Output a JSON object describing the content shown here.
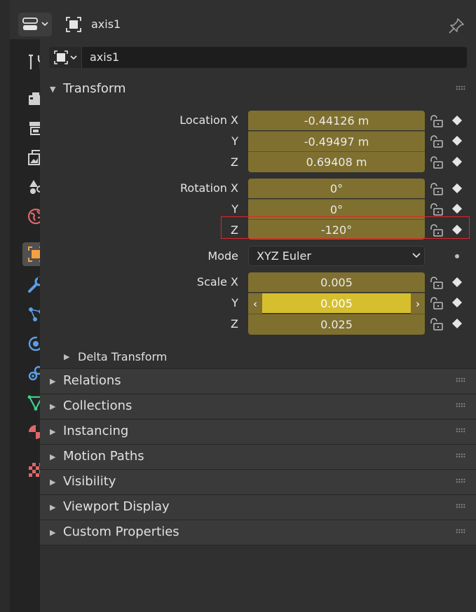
{
  "header": {
    "title": "axis1"
  },
  "object_name": "axis1",
  "transform": {
    "title": "Transform",
    "location": [
      {
        "label": "Location X",
        "value": "-0.44126 m"
      },
      {
        "label": "Y",
        "value": "-0.49497 m"
      },
      {
        "label": "Z",
        "value": "0.69408 m"
      }
    ],
    "rotation": [
      {
        "label": "Rotation X",
        "value": "0°"
      },
      {
        "label": "Y",
        "value": "0°"
      },
      {
        "label": "Z",
        "value": "-120°"
      }
    ],
    "mode": {
      "label": "Mode",
      "value": "XYZ Euler"
    },
    "scale": [
      {
        "label": "Scale X",
        "value": "0.005"
      },
      {
        "label": "Y",
        "value": "0.005"
      },
      {
        "label": "Z",
        "value": "0.025"
      }
    ],
    "delta": "Delta Transform"
  },
  "panels": [
    "Relations",
    "Collections",
    "Instancing",
    "Motion Paths",
    "Visibility",
    "Viewport Display",
    "Custom Properties"
  ],
  "colors": {
    "field": "#7f7030",
    "field_hover": "#d6bf2e",
    "highlight": "#e0262a",
    "active_tab": "#f5a043"
  },
  "tabs": [
    "tool-icon",
    "render-icon",
    "output-icon",
    "view-layer-icon",
    "scene-icon",
    "world-icon",
    "object-icon",
    "modifier-icon",
    "particles-icon",
    "physics-icon",
    "constraints-icon",
    "data-icon",
    "material-icon",
    "texture-icon"
  ]
}
